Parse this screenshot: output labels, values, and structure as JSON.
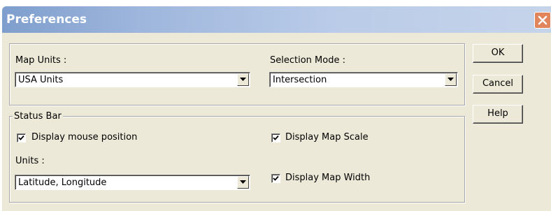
{
  "window": {
    "title": "Preferences"
  },
  "map_units": {
    "label": "Map Units :",
    "value": "USA Units"
  },
  "selection_mode": {
    "label": "Selection Mode :",
    "value": "Intersection"
  },
  "status_bar": {
    "group_label": "Status Bar",
    "display_mouse_position": {
      "label": "Display mouse position",
      "checked": true
    },
    "display_map_scale": {
      "label": "Display Map Scale",
      "checked": true
    },
    "display_map_width": {
      "label": "Display Map Width",
      "checked": true
    },
    "units": {
      "label": "Units :",
      "value": "Latitude, Longitude"
    }
  },
  "buttons": {
    "ok": "OK",
    "cancel": "Cancel",
    "help": "Help"
  },
  "colors": {
    "dialog_background": "#ece9d8",
    "titlebar_start": "#7e9ecd",
    "titlebar_end": "#c6d4ea",
    "close_button": "#e0855c"
  },
  "icons": {
    "close": "close-x-icon",
    "dropdown": "dropdown-arrow-icon",
    "check": "checkmark-icon"
  }
}
